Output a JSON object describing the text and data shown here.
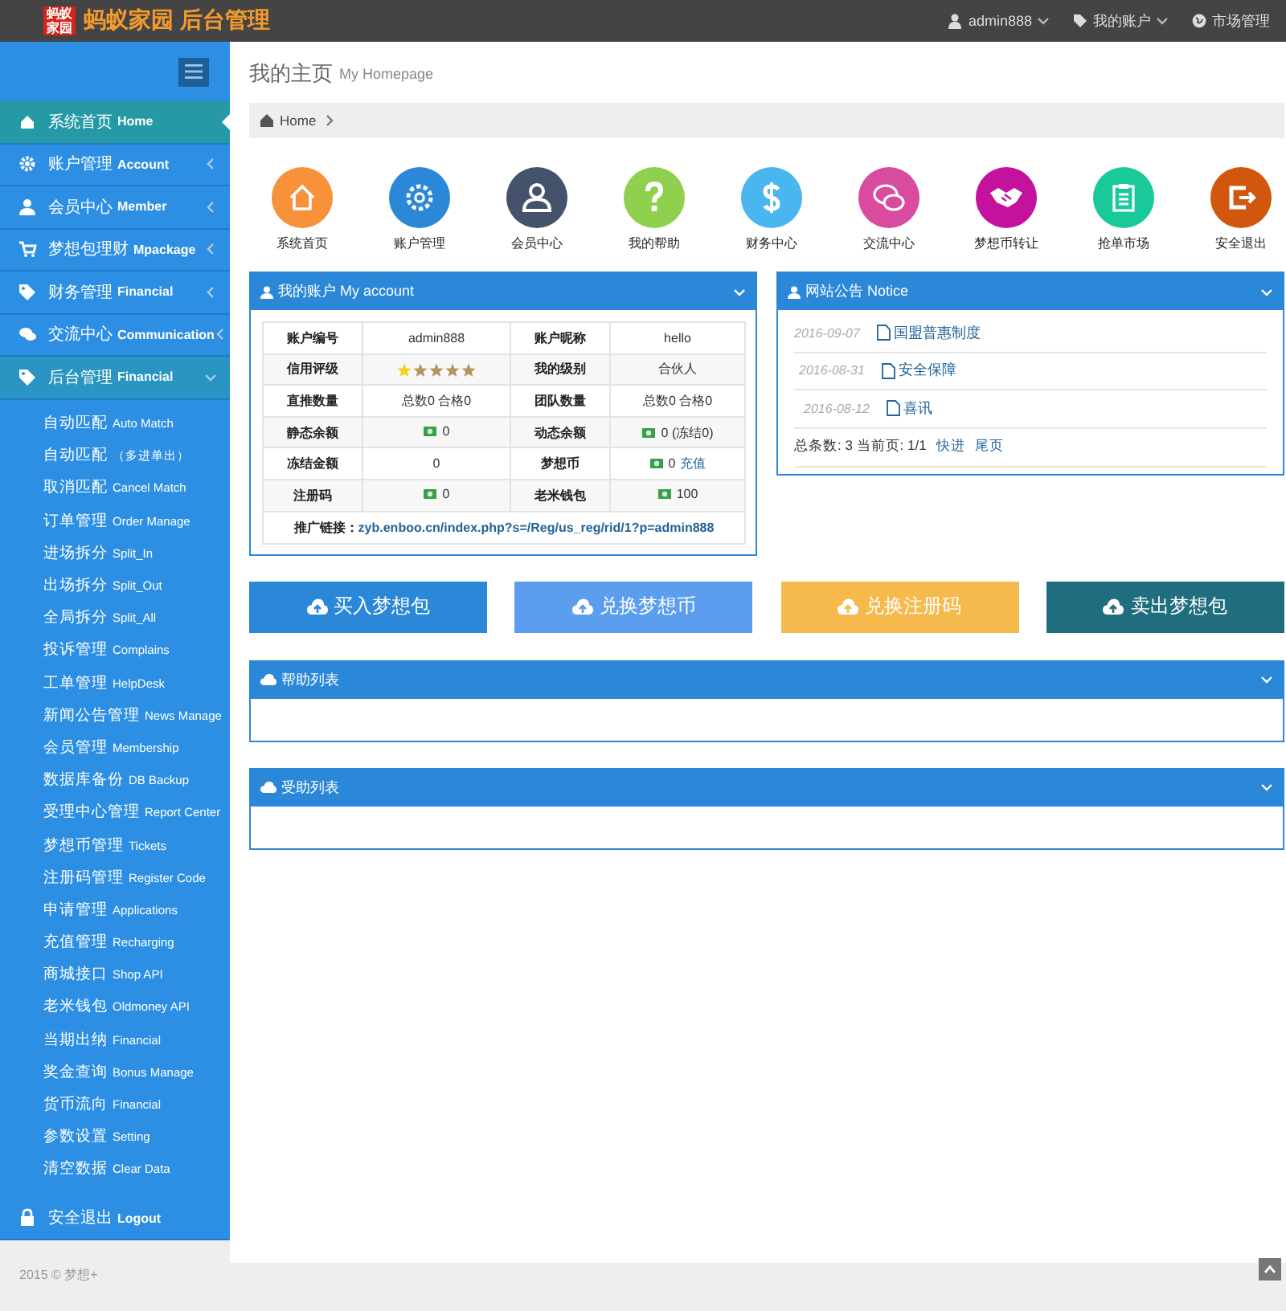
{
  "header": {
    "logo_mark": "蚂蚁家园",
    "logo_text": "蚂蚁家园 后台管理",
    "menus": [
      {
        "label": "admin888",
        "caret": true
      },
      {
        "label": "我的账户",
        "caret": true
      },
      {
        "label": "市场管理",
        "caret": false
      }
    ]
  },
  "sidebar": {
    "items": [
      {
        "label": "系统首页",
        "sub": "Home",
        "selected": true
      },
      {
        "label": "账户管理",
        "sub": "Account",
        "selected": false,
        "expanded": false
      },
      {
        "label": "会员中心",
        "sub": "Member",
        "selected": false,
        "expanded": false
      },
      {
        "label": "梦想包理财",
        "sub": "Mpackage",
        "selected": false,
        "expanded": false
      },
      {
        "label": "财务管理",
        "sub": "Financial",
        "selected": false,
        "expanded": false
      },
      {
        "label": "交流中心",
        "sub": "Communication",
        "selected": false,
        "expanded": false
      },
      {
        "label": "后台管理",
        "sub": "Financial",
        "selected": false,
        "expanded": true,
        "children": [
          {
            "label": "自动匹配",
            "sub": "Auto Match"
          },
          {
            "label": "自动匹配",
            "sub": "（多进单出）"
          },
          {
            "label": "取消匹配",
            "sub": "Cancel Match"
          },
          {
            "label": "订单管理",
            "sub": "Order Manage"
          },
          {
            "label": "进场拆分",
            "sub": "Split_In"
          },
          {
            "label": "出场拆分",
            "sub": "Split_Out"
          },
          {
            "label": "全局拆分",
            "sub": "Split_All"
          },
          {
            "label": "投诉管理",
            "sub": "Complains"
          },
          {
            "label": "工单管理",
            "sub": "HelpDesk"
          },
          {
            "label": "新闻公告管理",
            "sub": "News Manage"
          },
          {
            "label": "会员管理",
            "sub": "Membership"
          },
          {
            "label": "数据库备份",
            "sub": "DB Backup"
          },
          {
            "label": "受理中心管理",
            "sub": "Report Center"
          },
          {
            "label": "梦想币管理",
            "sub": "Tickets"
          },
          {
            "label": "注册码管理",
            "sub": "Register Code"
          },
          {
            "label": "申请管理",
            "sub": "Applications"
          },
          {
            "label": "充值管理",
            "sub": "Recharging"
          },
          {
            "label": "商城接口",
            "sub": "Shop API"
          },
          {
            "label": "老米钱包",
            "sub": "Oldmoney API"
          },
          {
            "label": "当期出纳",
            "sub": "Financial"
          },
          {
            "label": "奖金查询",
            "sub": "Bonus Manage"
          },
          {
            "label": "货币流向",
            "sub": "Financial"
          },
          {
            "label": "参数设置",
            "sub": "Setting"
          },
          {
            "label": "清空数据",
            "sub": "Clear Data"
          }
        ]
      },
      {
        "label": "安全退出",
        "sub": "Logout",
        "selected": false
      }
    ]
  },
  "page": {
    "title": "我的主页",
    "subtitle": "My Homepage",
    "breadcrumb": "Home"
  },
  "shortcuts": [
    {
      "label": "系统首页",
      "color": "#f7913a"
    },
    {
      "label": "账户管理",
      "color": "#2b88d8"
    },
    {
      "label": "会员中心",
      "color": "#44526b"
    },
    {
      "label": "我的帮助",
      "color": "#8fd14f"
    },
    {
      "label": "财务中心",
      "color": "#4ab6ef"
    },
    {
      "label": "交流中心",
      "color": "#d84b9f"
    },
    {
      "label": "梦想币转让",
      "color": "#c4129e"
    },
    {
      "label": "抢单市场",
      "color": "#19c99a"
    },
    {
      "label": "安全退出",
      "color": "#d1570e"
    }
  ],
  "account": {
    "title": "我的账户 My account",
    "rows": [
      [
        {
          "kind": "label",
          "text": "账户编号"
        },
        {
          "kind": "text",
          "text": "admin888"
        },
        {
          "kind": "label",
          "text": "账户昵称"
        },
        {
          "kind": "text",
          "text": "hello"
        }
      ],
      [
        {
          "kind": "label",
          "text": "信用评级"
        },
        {
          "kind": "stars",
          "stars": 1
        },
        {
          "kind": "label",
          "text": "我的级别"
        },
        {
          "kind": "text",
          "text": "合伙人"
        }
      ],
      [
        {
          "kind": "label",
          "text": "直推数量"
        },
        {
          "kind": "text",
          "text": "总数0 合格0"
        },
        {
          "kind": "label",
          "text": "团队数量"
        },
        {
          "kind": "text",
          "text": "总数0 合格0"
        }
      ],
      [
        {
          "kind": "label",
          "text": "静态余额"
        },
        {
          "kind": "money",
          "text": "0"
        },
        {
          "kind": "label",
          "text": "动态余额"
        },
        {
          "kind": "money",
          "text": "0 (冻结0)"
        }
      ],
      [
        {
          "kind": "label",
          "text": "冻结金额"
        },
        {
          "kind": "text",
          "text": "0"
        },
        {
          "kind": "label",
          "text": "梦想币"
        },
        {
          "kind": "money",
          "text": "0",
          "link": "充值"
        }
      ],
      [
        {
          "kind": "label",
          "text": "注册码"
        },
        {
          "kind": "money",
          "text": "0"
        },
        {
          "kind": "label",
          "text": "老米钱包"
        },
        {
          "kind": "money",
          "text": "100"
        }
      ]
    ],
    "promo_label": "推广链接：",
    "promo_link": "zyb.enboo.cn/index.php?s=/Reg/us_reg/rid/1?p=admin888"
  },
  "notice": {
    "title": "网站公告 Notice",
    "items": [
      {
        "date": "2016-09-07",
        "title": "国盟普惠制度"
      },
      {
        "date": "2016-08-31",
        "title": "安全保障"
      },
      {
        "date": "2016-08-12",
        "title": "喜讯"
      }
    ],
    "summary": "总条数: 3 当前页: 1/1",
    "links": [
      "快进",
      "尾页"
    ]
  },
  "actions": [
    {
      "label": "买入梦想包",
      "color": "#2b88d8"
    },
    {
      "label": "兑换梦想币",
      "color": "#5b9ef0"
    },
    {
      "label": "兑换注册码",
      "color": "#f5b94c"
    },
    {
      "label": "卖出梦想包",
      "color": "#1f6d7e"
    }
  ],
  "lists": [
    {
      "title": "帮助列表"
    },
    {
      "title": "受助列表"
    }
  ],
  "footer": {
    "copyright": "2015 © 梦想+"
  }
}
